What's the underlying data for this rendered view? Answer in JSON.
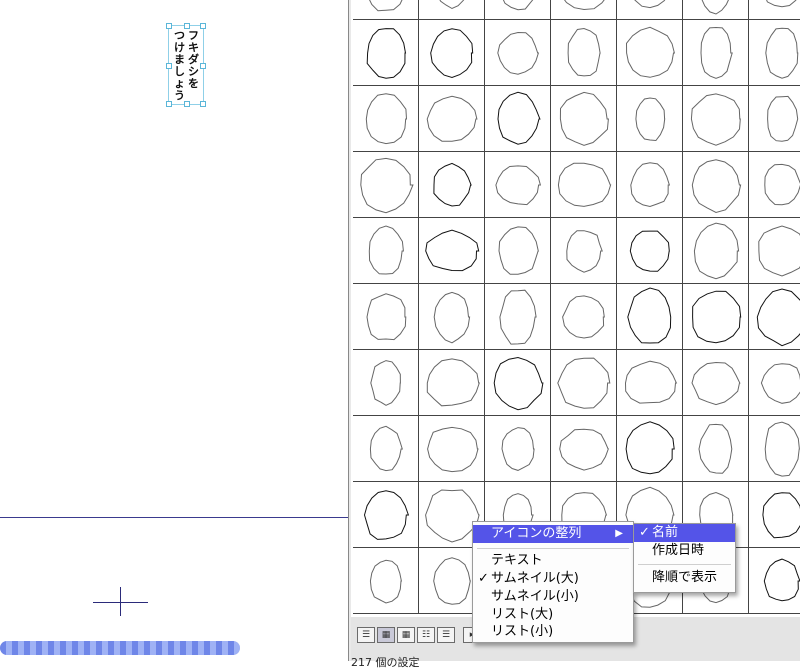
{
  "canvas": {
    "balloon_columns": [
      "フキダシを",
      "つけましょう"
    ]
  },
  "progress": {
    "value": 1.0
  },
  "context_menu": {
    "items": [
      {
        "label": "アイコンの整列",
        "highlighted": true,
        "has_submenu": true
      },
      {
        "label": "テキスト",
        "checked": false
      },
      {
        "label": "サムネイル(大)",
        "checked": true
      },
      {
        "label": "サムネイル(小)",
        "checked": false
      },
      {
        "label": "リスト(大)",
        "checked": false
      },
      {
        "label": "リスト(小)",
        "checked": false
      }
    ],
    "checkmark": "✓",
    "submenu_arrow": "▶"
  },
  "submenu": {
    "items": [
      {
        "label": "名前",
        "checked": true,
        "highlighted": true
      },
      {
        "label": "作成日時",
        "checked": false
      },
      {
        "label": "降順で表示",
        "checked": false
      }
    ]
  },
  "bottom_bar": {
    "status_text": "217 個の設定",
    "view_buttons": [
      "text-view",
      "large-thumbnail-view",
      "small-thumbnail-view",
      "large-list-view",
      "small-list-view",
      "options"
    ]
  },
  "colors": {
    "highlight": "#5454e8",
    "grid_line": "#444444",
    "selection": "#8fd0e8"
  },
  "icons": [
    "balloon-shape-thumbnail",
    "checkmark-icon",
    "submenu-arrow-icon",
    "crosshair-cursor-icon"
  ]
}
